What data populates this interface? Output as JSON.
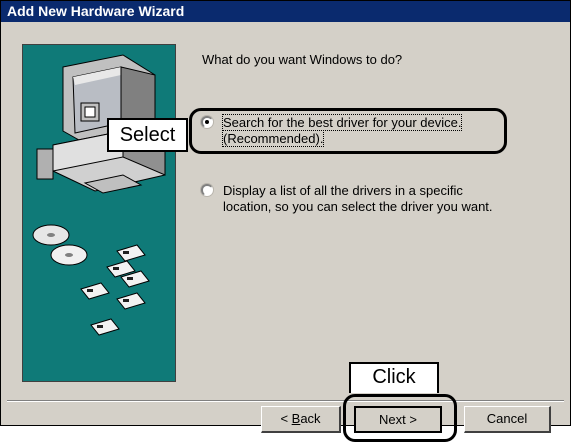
{
  "window": {
    "title": "Add New Hardware Wizard"
  },
  "main": {
    "question": "What do you want Windows to do?",
    "options": [
      {
        "selected": true,
        "line1": "Search for the best driver for your device.",
        "line2": "(Recommended)."
      },
      {
        "selected": false,
        "line1": "Display a list of all the drivers in a specific",
        "line2": "location, so you can select the driver you want."
      }
    ]
  },
  "annotations": {
    "select_label": "Select",
    "click_label": "Click"
  },
  "buttons": {
    "back_prefix": "< ",
    "back_mnemonic": "B",
    "back_rest": "ack",
    "next_label": "Next >",
    "cancel_label": "Cancel"
  },
  "colors": {
    "titlebar": "#0a2a6e",
    "artwork_background": "#0f7a78",
    "dialog_face": "#d4d0c8"
  },
  "icons": [
    "computer-icon",
    "cd-disc-icon",
    "floppy-disk-icon"
  ]
}
